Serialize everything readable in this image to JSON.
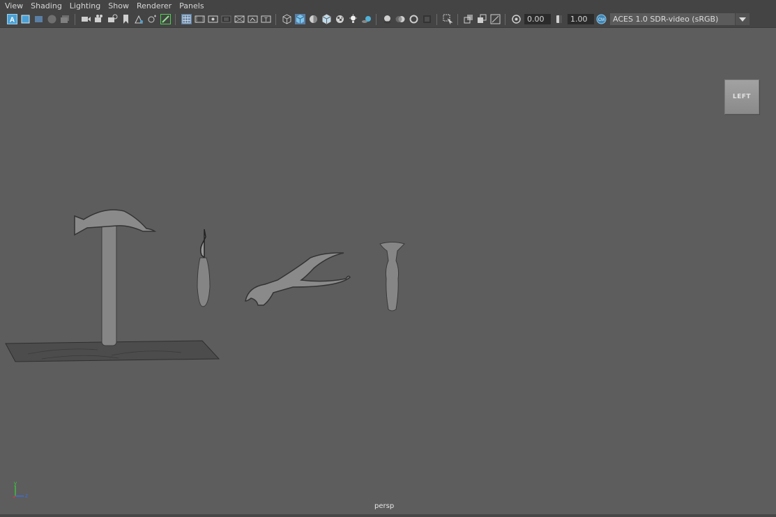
{
  "menubar": {
    "items": [
      {
        "label": "View"
      },
      {
        "label": "Shading"
      },
      {
        "label": "Lighting"
      },
      {
        "label": "Show"
      },
      {
        "label": "Renderer"
      },
      {
        "label": "Panels"
      }
    ]
  },
  "toolbar": {
    "exposure_value": "0.00",
    "gamma_value": "1.00",
    "color_space": "ACES 1.0 SDR-video (sRGB)",
    "icons": [
      "select-camera-icon",
      "camera-attributes-icon",
      "bookmark-icon",
      "image-plane-icon",
      "grid-icon",
      "film-gate-icon",
      "resolution-gate-icon",
      "gate-mask-icon",
      "field-chart-icon",
      "safe-action-icon",
      "safe-title-icon",
      "wireframe-icon",
      "smooth-shade-icon",
      "default-material-icon",
      "textured-icon",
      "use-all-lights-icon",
      "shadows-icon",
      "screen-space-ao-icon",
      "motion-blur-icon",
      "anti-aliasing-icon",
      "depth-of-field-icon",
      "isolate-select-icon",
      "xray-icon",
      "xray-active-icon",
      "xray-joints-icon",
      "exposure-icon",
      "gamma-icon",
      "color-management-icon"
    ]
  },
  "viewport": {
    "viewcube_label": "LEFT",
    "camera_label": "persp",
    "axis_y": "y",
    "axis_z": "z",
    "background_color": "#5d5d5d"
  },
  "objects": [
    "hammer",
    "stitching-awl",
    "leather-pliers",
    "edge-slicker"
  ]
}
